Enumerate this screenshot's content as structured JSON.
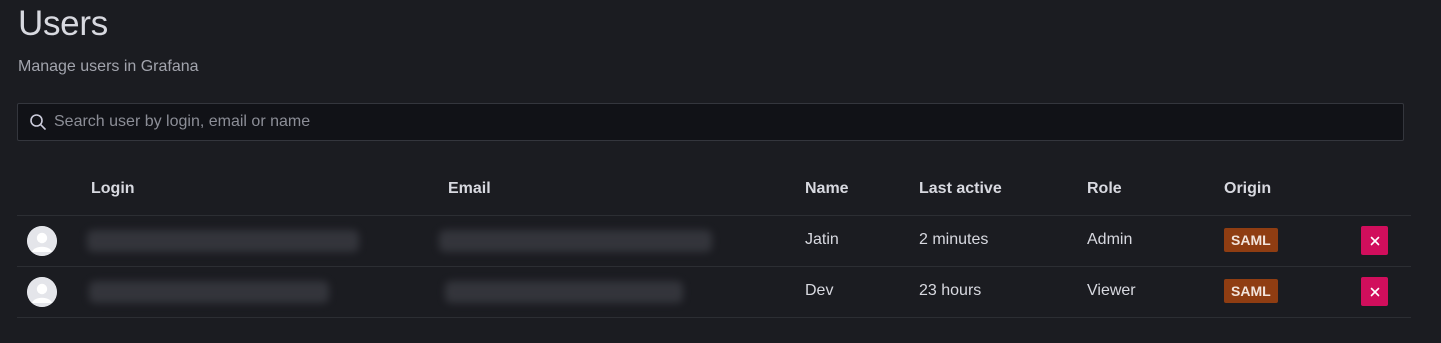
{
  "page": {
    "title": "Users",
    "subtitle": "Manage users in Grafana"
  },
  "search": {
    "placeholder": "Search user by login, email or name",
    "value": ""
  },
  "table": {
    "columns": {
      "login": "Login",
      "email": "Email",
      "name": "Name",
      "last_active": "Last active",
      "role": "Role",
      "origin": "Origin"
    },
    "rows": [
      {
        "login": "",
        "email": "",
        "name": "Jatin",
        "last_active": "2 minutes",
        "role": "Admin",
        "origin": "SAML"
      },
      {
        "login": "",
        "email": "",
        "name": "Dev",
        "last_active": "23 hours",
        "role": "Viewer",
        "origin": "SAML"
      }
    ]
  },
  "icons": {
    "search": "search-icon",
    "avatar": "user-avatar-icon",
    "delete": "close-icon"
  },
  "colors": {
    "background": "#1b1c21",
    "origin_badge": "#8f3d12",
    "delete_button": "#d10e5c"
  }
}
